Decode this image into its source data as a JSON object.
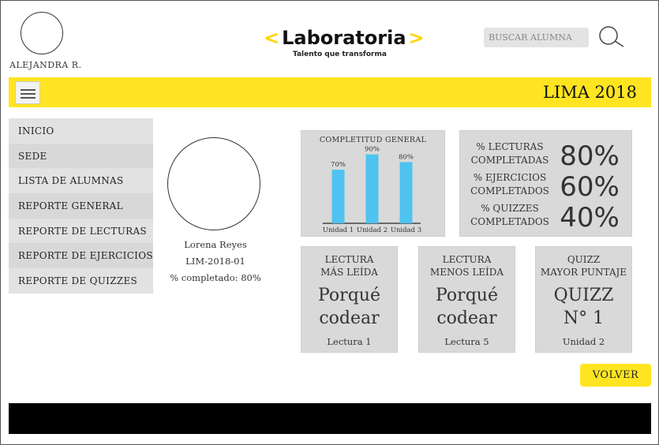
{
  "user": {
    "name": "ALEJANDRA R."
  },
  "brand": {
    "name": "Laboratoria",
    "chevron_left": "<",
    "chevron_right": ">",
    "tagline": "Talento que transforma",
    "accent": "#ffe521"
  },
  "search": {
    "placeholder": "BUSCAR ALUMNA",
    "icon": "search-icon"
  },
  "topbar": {
    "title": "LIMA 2018",
    "menu_icon": "hamburger-icon"
  },
  "sidebar": {
    "items": [
      {
        "label": "INICIO"
      },
      {
        "label": "SEDE"
      },
      {
        "label": "LISTA DE ALUMNAS"
      },
      {
        "label": "REPORTE GENERAL"
      },
      {
        "label": "REPORTE DE LECTURAS"
      },
      {
        "label": "REPORTE DE EJERCICIOS"
      },
      {
        "label": "REPORTE DE QUIZZES"
      }
    ]
  },
  "student": {
    "name": "Lorena Reyes",
    "code": "LIM-2018-01",
    "completion": "% completado:  80%"
  },
  "chart_data": {
    "type": "bar",
    "title": "COMPLETITUD GENERAL",
    "categories": [
      "Unidad 1",
      "Unidad 2",
      "Unidad 3"
    ],
    "values": [
      70,
      90,
      80
    ],
    "value_labels": [
      "70%",
      "90%",
      "80%"
    ],
    "ylim": [
      0,
      100
    ],
    "bar_color": "#4fc3f0",
    "grid": false
  },
  "percentages": [
    {
      "label_line1": "% LECTURAS",
      "label_line2": "COMPLETADAS",
      "value": "80%"
    },
    {
      "label_line1": "% EJERCICIOS",
      "label_line2": "COMPLETADOS",
      "value": "60%"
    },
    {
      "label_line1": "% QUIZZES",
      "label_line2": "COMPLETADOS",
      "value": "40%"
    }
  ],
  "stats": [
    {
      "label_line1": "LECTURA",
      "label_line2": "MÁS LEÍDA",
      "value_line1": "Porqué",
      "value_line2": "codear",
      "footer": "Lectura 1"
    },
    {
      "label_line1": "LECTURA",
      "label_line2": "MENOS LEÍDA",
      "value_line1": "Porqué",
      "value_line2": "codear",
      "footer": "Lectura 5"
    },
    {
      "label_line1": "QUIZZ",
      "label_line2": "MAYOR PUNTAJE",
      "value_line1": "QUIZZ",
      "value_line2": "N° 1",
      "footer": "Unidad 2"
    }
  ],
  "actions": {
    "back_label": "VOLVER"
  }
}
